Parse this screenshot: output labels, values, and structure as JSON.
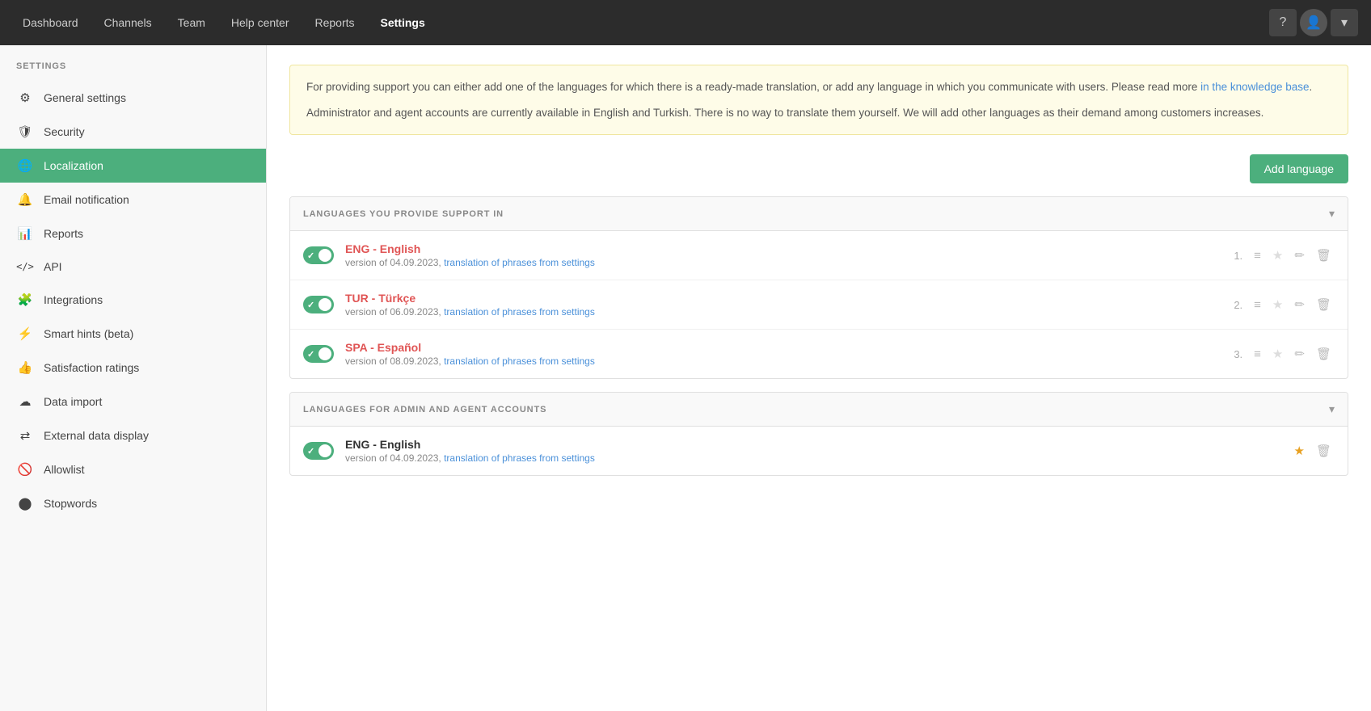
{
  "nav": {
    "items": [
      {
        "label": "Dashboard",
        "active": false
      },
      {
        "label": "Channels",
        "active": false
      },
      {
        "label": "Team",
        "active": false
      },
      {
        "label": "Help center",
        "active": false
      },
      {
        "label": "Reports",
        "active": false
      },
      {
        "label": "Settings",
        "active": true
      }
    ]
  },
  "sidebar": {
    "heading": "SETTINGS",
    "items": [
      {
        "label": "General settings",
        "icon": "⚙",
        "active": false,
        "name": "general-settings"
      },
      {
        "label": "Security",
        "icon": "🛡",
        "active": false,
        "name": "security"
      },
      {
        "label": "Localization",
        "icon": "🌐",
        "active": true,
        "name": "localization"
      },
      {
        "label": "Email notification",
        "icon": "🔔",
        "active": false,
        "name": "email-notification"
      },
      {
        "label": "Reports",
        "icon": "📊",
        "active": false,
        "name": "reports"
      },
      {
        "label": "API",
        "icon": "</>",
        "active": false,
        "name": "api"
      },
      {
        "label": "Integrations",
        "icon": "🧩",
        "active": false,
        "name": "integrations"
      },
      {
        "label": "Smart hints (beta)",
        "icon": "⚡",
        "active": false,
        "name": "smart-hints"
      },
      {
        "label": "Satisfaction ratings",
        "icon": "👍",
        "active": false,
        "name": "satisfaction-ratings"
      },
      {
        "label": "Data import",
        "icon": "☁",
        "active": false,
        "name": "data-import"
      },
      {
        "label": "External data display",
        "icon": "⇄",
        "active": false,
        "name": "external-data"
      },
      {
        "label": "Allowlist",
        "icon": "🚫",
        "active": false,
        "name": "allowlist"
      },
      {
        "label": "Stopwords",
        "icon": "🔘",
        "active": false,
        "name": "stopwords"
      }
    ]
  },
  "info_banner": {
    "text1": "For providing support you can either add one of the languages for which there is a ready-made translation, or add any language in which you communicate with users. Please read more ",
    "link_text": "in the knowledge base",
    "link_href": "#",
    "text2": ".",
    "text3": "Administrator and agent accounts are currently available in English and Turkish. There is no way to translate them yourself. We will add other languages as their demand among customers increases."
  },
  "add_language_btn": "Add language",
  "sections": [
    {
      "title": "LANGUAGES YOU PROVIDE SUPPORT IN",
      "name": "support-languages-section",
      "languages": [
        {
          "num": "1.",
          "name": "ENG - English",
          "red": true,
          "version": "version of 04.09.2023, ",
          "link_text": "translation of phrases from settings",
          "enabled": true,
          "starred": false
        },
        {
          "num": "2.",
          "name": "TUR - Türkçe",
          "red": true,
          "version": "version of 06.09.2023, ",
          "link_text": "translation of phrases from settings",
          "enabled": true,
          "starred": false
        },
        {
          "num": "3.",
          "name": "SPA - Español",
          "red": true,
          "version": "version of 08.09.2023, ",
          "link_text": "translation of phrases from settings",
          "enabled": true,
          "starred": false
        }
      ]
    },
    {
      "title": "LANGUAGES FOR ADMIN AND AGENT ACCOUNTS",
      "name": "admin-languages-section",
      "languages": [
        {
          "num": "",
          "name": "ENG - English",
          "red": false,
          "version": "version of 04.09.2023, ",
          "link_text": "translation of phrases from settings",
          "enabled": true,
          "starred": true
        }
      ]
    }
  ]
}
